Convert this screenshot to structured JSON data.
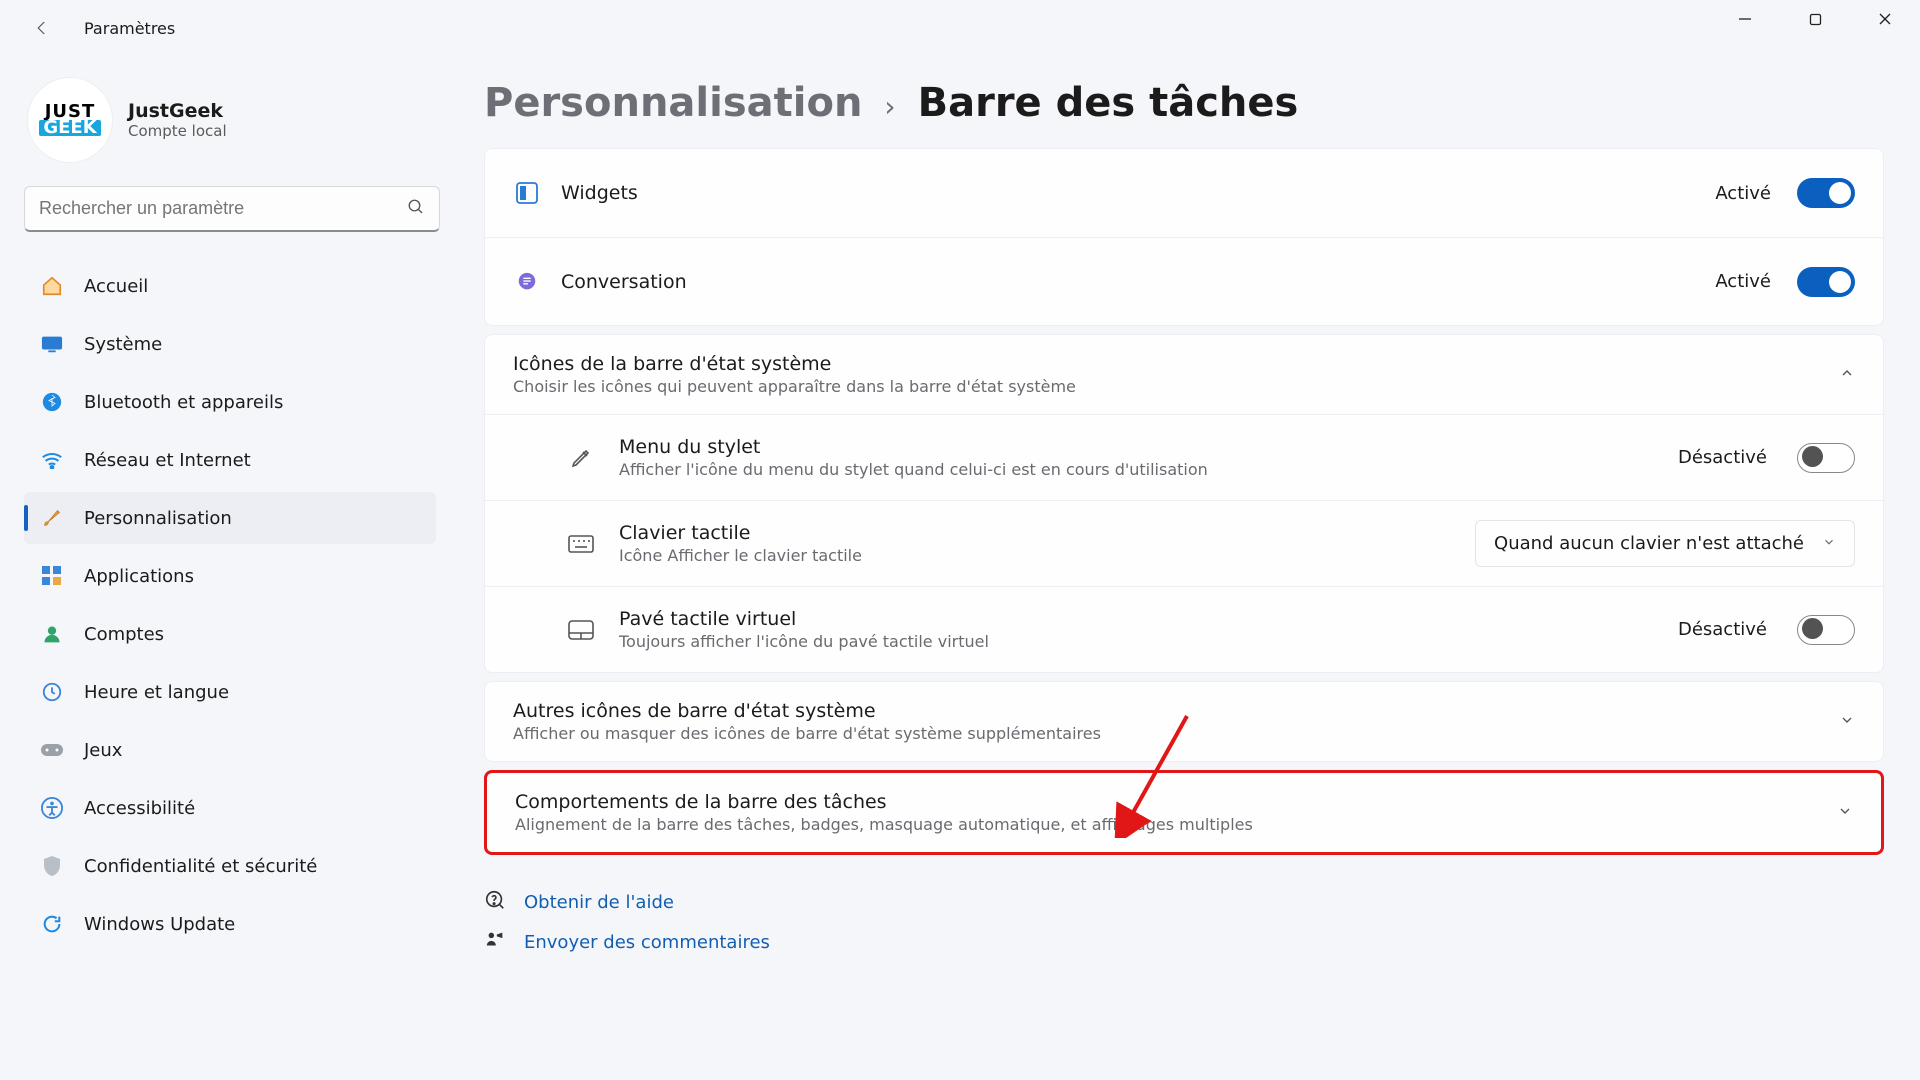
{
  "window": {
    "title": "Paramètres"
  },
  "account": {
    "name": "JustGeek",
    "type": "Compte local",
    "logo1": "JUST",
    "logo2": "GEEK"
  },
  "search": {
    "placeholder": "Rechercher un paramètre"
  },
  "nav": {
    "home": "Accueil",
    "system": "Système",
    "bluetooth": "Bluetooth et appareils",
    "network": "Réseau et Internet",
    "personalization": "Personnalisation",
    "apps": "Applications",
    "accounts": "Comptes",
    "time": "Heure et langue",
    "gaming": "Jeux",
    "accessibility": "Accessibilité",
    "privacy": "Confidentialité et sécurité",
    "update": "Windows Update"
  },
  "breadcrumb": {
    "parent": "Personnalisation",
    "current": "Barre des tâches"
  },
  "taskbar_items": {
    "widgets": {
      "label": "Widgets",
      "status": "Activé",
      "on": true
    },
    "chat": {
      "label": "Conversation",
      "status": "Activé",
      "on": true
    }
  },
  "systray_header": {
    "title": "Icônes de la barre d'état système",
    "sub": "Choisir les icônes qui peuvent apparaître dans la barre d'état système"
  },
  "systray": {
    "pen": {
      "title": "Menu du stylet",
      "sub": "Afficher l'icône du menu du stylet quand celui-ci est en cours d'utilisation",
      "status": "Désactivé",
      "on": false
    },
    "touch_keyboard": {
      "title": "Clavier tactile",
      "sub": "Icône Afficher le clavier tactile",
      "dropdown": "Quand aucun clavier n'est attaché"
    },
    "touchpad": {
      "title": "Pavé tactile virtuel",
      "sub": "Toujours afficher l'icône du pavé tactile virtuel",
      "status": "Désactivé",
      "on": false
    }
  },
  "other_icons": {
    "title": "Autres icônes de barre d'état système",
    "sub": "Afficher ou masquer des icônes de barre d'état système supplémentaires"
  },
  "behaviors": {
    "title": "Comportements de la barre des tâches",
    "sub": "Alignement de la barre des tâches, badges, masquage automatique, et affichages multiples"
  },
  "help": {
    "get_help": "Obtenir de l'aide",
    "feedback": "Envoyer des commentaires"
  }
}
